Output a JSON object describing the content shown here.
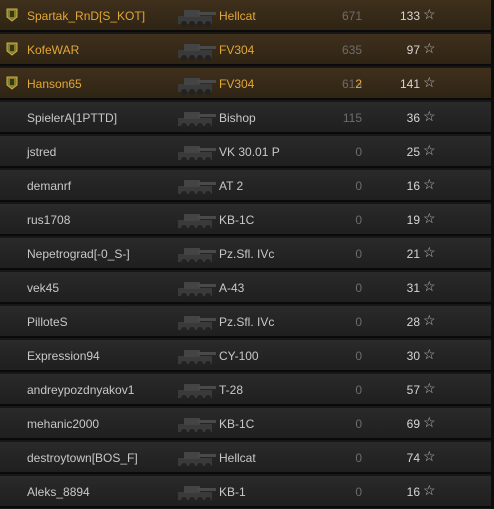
{
  "rows": [
    {
      "name": "Spartak_RnD[S_KOT]",
      "tank": "Hellcat",
      "damage": "671",
      "kills": "",
      "xp": "133",
      "squad": true
    },
    {
      "name": "KofeWAR",
      "tank": "FV304",
      "damage": "635",
      "kills": "",
      "xp": "97",
      "squad": true
    },
    {
      "name": "Hanson65",
      "tank": "FV304",
      "damage": "613",
      "kills": "2",
      "xp": "141",
      "squad": true
    },
    {
      "name": "SpielerA[1PTTD]",
      "tank": "Bishop",
      "damage": "115",
      "kills": "",
      "xp": "36",
      "squad": false
    },
    {
      "name": "jstred",
      "tank": "VK 30.01 P",
      "damage": "0",
      "kills": "",
      "xp": "25",
      "squad": false
    },
    {
      "name": "demanrf",
      "tank": "AT 2",
      "damage": "0",
      "kills": "",
      "xp": "16",
      "squad": false
    },
    {
      "name": "rus1708",
      "tank": "KB-1C",
      "damage": "0",
      "kills": "",
      "xp": "19",
      "squad": false
    },
    {
      "name": "Nepetrograd[-0_S-]",
      "tank": "Pz.Sfl. IVc",
      "damage": "0",
      "kills": "",
      "xp": "21",
      "squad": false
    },
    {
      "name": "vek45",
      "tank": "A-43",
      "damage": "0",
      "kills": "",
      "xp": "31",
      "squad": false
    },
    {
      "name": "PilloteS",
      "tank": "Pz.Sfl. IVc",
      "damage": "0",
      "kills": "",
      "xp": "28",
      "squad": false
    },
    {
      "name": "Expression94",
      "tank": "CY-100",
      "damage": "0",
      "kills": "",
      "xp": "30",
      "squad": false
    },
    {
      "name": "andreypozdnyakov1",
      "tank": "T-28",
      "damage": "0",
      "kills": "",
      "xp": "57",
      "squad": false
    },
    {
      "name": "mehanic2000",
      "tank": "KB-1C",
      "damage": "0",
      "kills": "",
      "xp": "69",
      "squad": false
    },
    {
      "name": "destroytown[BOS_F]",
      "tank": "Hellcat",
      "damage": "0",
      "kills": "",
      "xp": "74",
      "squad": false
    },
    {
      "name": "Aleks_8894",
      "tank": "KB-1",
      "damage": "0",
      "kills": "",
      "xp": "16",
      "squad": false
    }
  ],
  "colors": {
    "squad_text": "#e4a637",
    "normal_text": "#c8c8c8",
    "damage_text": "#6d6d6d"
  },
  "icons": {
    "squad": "squad-badge-icon",
    "tank": "tank-silhouette-icon",
    "star": "star-icon"
  }
}
